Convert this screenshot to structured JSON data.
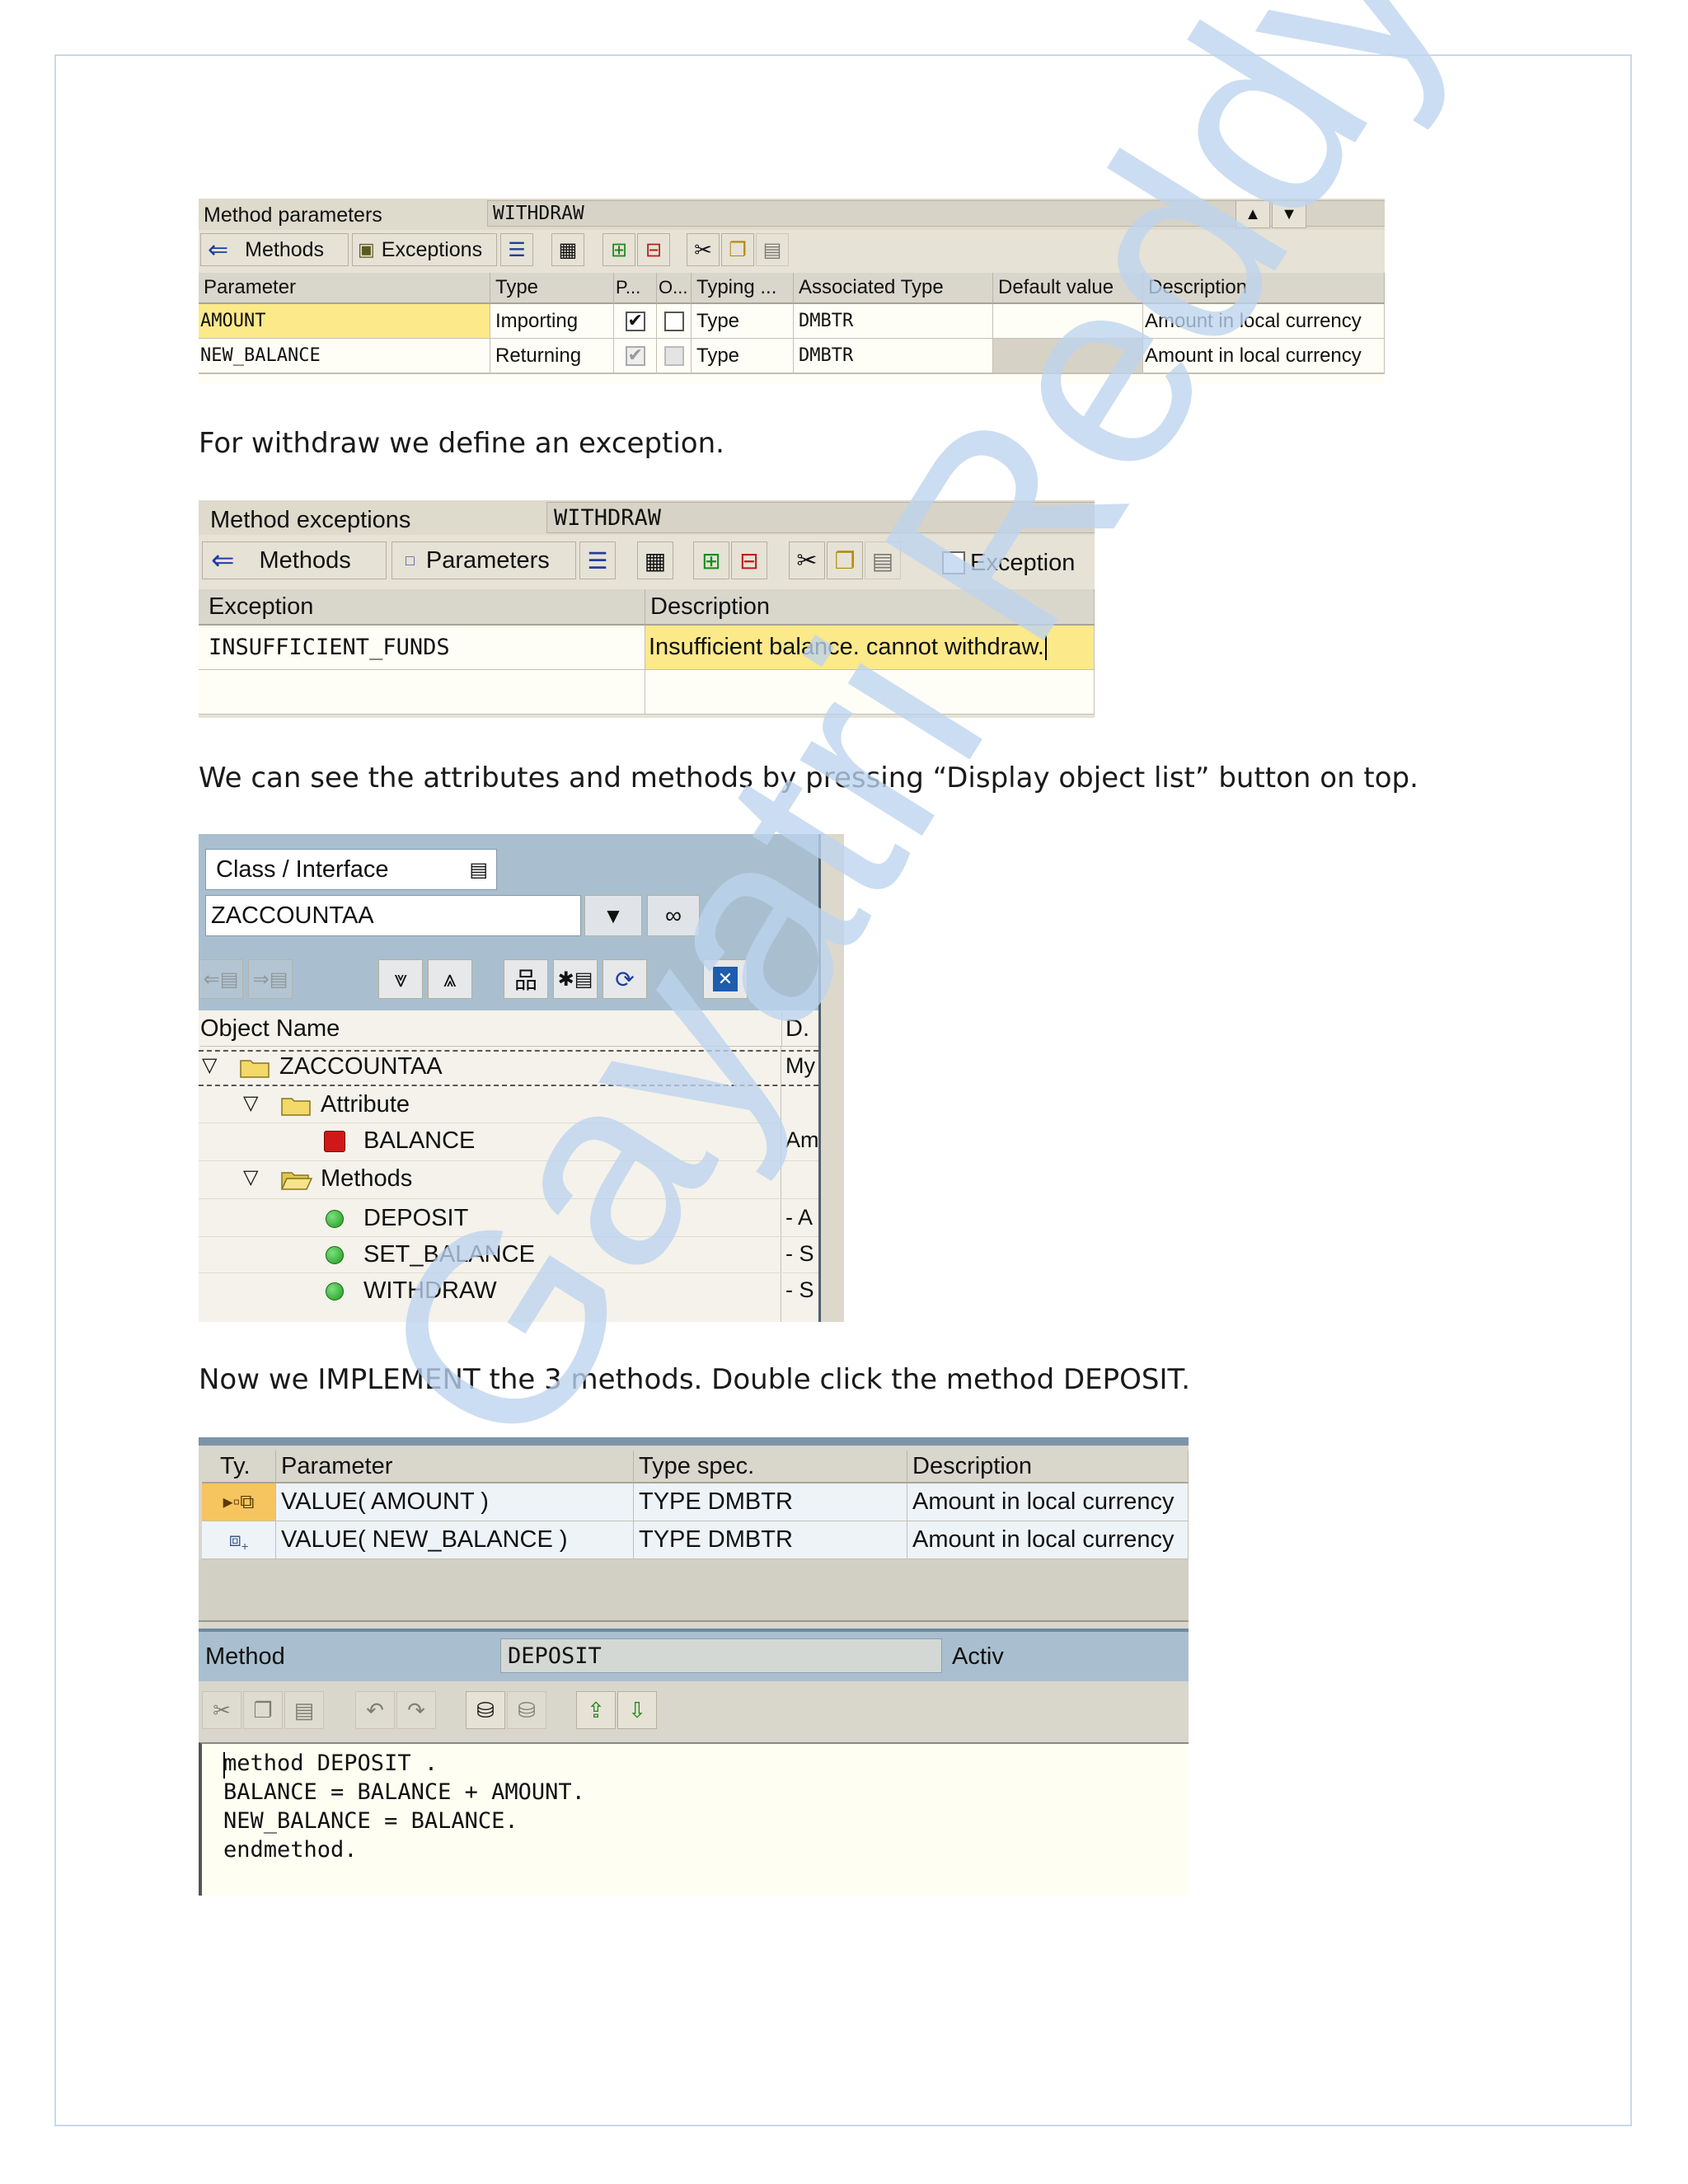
{
  "paragraphs": {
    "p1": "For withdraw we define an exception.",
    "p2": "We can see the attributes and methods by pressing “Display object list” button on top.",
    "p3": "Now we IMPLEMENT the 3 methods. Double click the method DEPOSIT."
  },
  "screen1": {
    "title_label": "Method parameters",
    "method_name": "WITHDRAW",
    "toolbar": {
      "methods_label": "Methods",
      "exceptions_label": "Exceptions"
    },
    "columns": [
      "Parameter",
      "Type",
      "P...",
      "O...",
      "Typing ...",
      "Associated Type",
      "Default value",
      "Description"
    ],
    "rows": [
      {
        "parameter": "AMOUNT",
        "type": "Importing",
        "typing": "Type",
        "assoc": "DMBTR",
        "default": "",
        "description": "Amount in local currency"
      },
      {
        "parameter": "NEW_BALANCE",
        "type": "Returning",
        "typing": "Type",
        "assoc": "DMBTR",
        "default": "",
        "description": "Amount in local currency"
      }
    ]
  },
  "screen2": {
    "title_label": "Method exceptions",
    "method_name": "WITHDRAW",
    "toolbar": {
      "methods_label": "Methods",
      "parameters_label": "Parameters",
      "exception_checkbox_label": "Exception"
    },
    "columns": [
      "Exception",
      "Description"
    ],
    "rows": [
      {
        "exception": "INSUFFICIENT_FUNDS",
        "description": "Insufficient balance. cannot withdraw."
      }
    ]
  },
  "screen3": {
    "dropdown_label": "Class / Interface",
    "class_value": "ZACCOUNTAA",
    "columns": [
      "Object Name",
      "D."
    ],
    "tree": {
      "root": {
        "label": "ZACCOUNTAA",
        "d": "My"
      },
      "attribute_folder": "Attribute",
      "balance": {
        "label": "BALANCE",
        "d": "Am"
      },
      "methods_folder": "Methods",
      "methods": [
        {
          "label": "DEPOSIT",
          "d": "- A"
        },
        {
          "label": "SET_BALANCE",
          "d": "- S"
        },
        {
          "label": "WITHDRAW",
          "d": "- S"
        }
      ]
    }
  },
  "screen4": {
    "columns": [
      "Ty.",
      "Parameter",
      "Type spec.",
      "Description"
    ],
    "rows": [
      {
        "parameter": "VALUE( AMOUNT )",
        "typespec": "TYPE DMBTR",
        "description": "Amount in local currency"
      },
      {
        "parameter": "VALUE( NEW_BALANCE )",
        "typespec": "TYPE DMBTR",
        "description": "Amount in local currency"
      }
    ],
    "method_label": "Method",
    "method_value": "DEPOSIT",
    "status": "Activ",
    "code": [
      "method DEPOSIT .",
      "BALANCE = BALANCE + AMOUNT.",
      "NEW_BALANCE = BALANCE.",
      "endmethod."
    ]
  },
  "watermark_text": "Gayatri Reddy",
  "colors": {
    "sap_bg": "#e6e2d6",
    "sap_header": "#d9d6cc",
    "cell_bg": "#fffef6",
    "highlight": "#fbe98a",
    "tree_blue": "#a9bfcf",
    "watermark": "#bcd3ee"
  }
}
